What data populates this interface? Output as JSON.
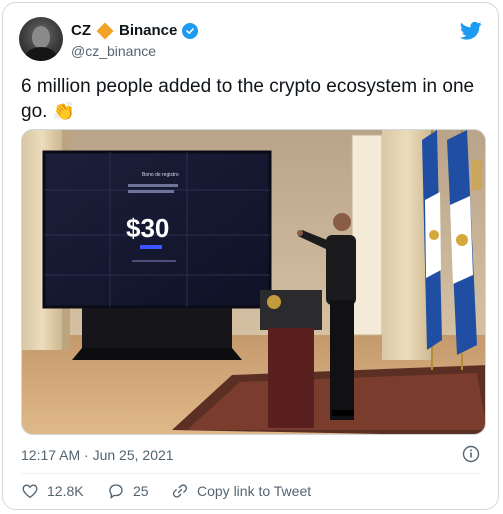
{
  "author": {
    "name": "CZ",
    "badge_name": "Binance",
    "handle": "@cz_binance",
    "verified": true
  },
  "tweet": {
    "text": "6 million people added to the crypto ecosystem in one go.",
    "emoji": "👏"
  },
  "photo": {
    "screen_title": "Bono de registro",
    "screen_amount": "$30"
  },
  "meta": {
    "timestamp": "12:17 AM · Jun 25, 2021"
  },
  "actions": {
    "likes": "12.8K",
    "replies": "25",
    "copy_link_label": "Copy link to Tweet"
  },
  "colors": {
    "accent": "#1d9bf0",
    "binance": "#f3a228",
    "muted": "#536471"
  },
  "icons": [
    "twitter-bird-icon",
    "verified-badge-icon",
    "info-icon",
    "heart-icon",
    "reply-icon",
    "link-icon"
  ]
}
